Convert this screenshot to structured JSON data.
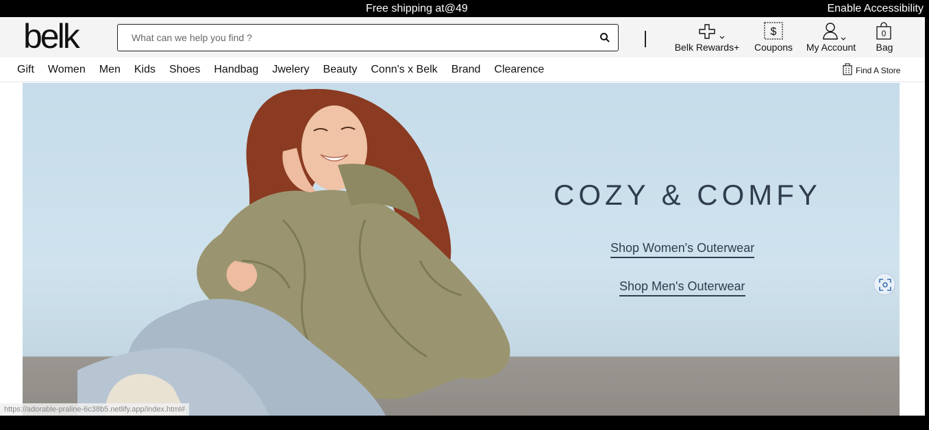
{
  "promo": {
    "text": "Free shipping at@49",
    "accessibility": "Enable Accessibility"
  },
  "header": {
    "logo": "belk",
    "search": {
      "placeholder": "What can we help you find ?",
      "value": ""
    },
    "icons": [
      "search-icon",
      "plus-icon",
      "chevron-down-icon",
      "coupon-icon",
      "user-icon",
      "bag-icon"
    ],
    "rewards_label": "Belk Rewards+",
    "coupons_label": "Coupons",
    "account_label": "My Account",
    "bag_label": "Bag",
    "bag_count": "0"
  },
  "nav": {
    "items": [
      "Gift",
      "Women",
      "Men",
      "Kids",
      "Shoes",
      "Handbag",
      "Jwelery",
      "Beauty",
      "Conn's x Belk",
      "Brand",
      "Clearence"
    ],
    "find_store": "Find A Store"
  },
  "hero": {
    "title": "COZY & COMFY",
    "link_women": "Shop Women's Outerwear",
    "link_men": "Shop Men's Outerwear"
  },
  "status_url": "https://adorable-praline-6c38b5.netlify.app/index.html#",
  "colors": {
    "promo_bg": "#000000",
    "header_bg": "#f4f4f4",
    "hero_bg": "#cfe2ee",
    "hero_text": "#2f3d4c",
    "jacket": "#9a9570"
  }
}
